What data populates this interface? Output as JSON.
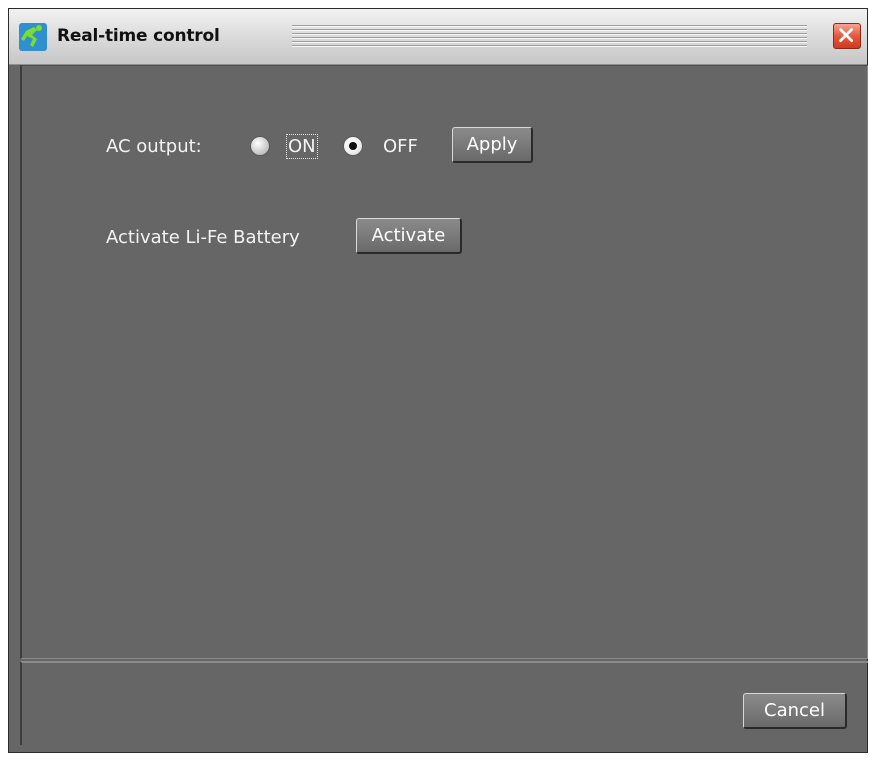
{
  "window": {
    "title": "Real-time control",
    "app_icon": "runner-icon",
    "close_icon": "close-icon"
  },
  "ac_output": {
    "label": "AC output:",
    "options": [
      {
        "label": "ON",
        "selected": false
      },
      {
        "label": "OFF",
        "selected": true
      }
    ],
    "apply_label": "Apply"
  },
  "battery": {
    "label": "Activate Li-Fe Battery",
    "activate_label": "Activate"
  },
  "footer": {
    "cancel_label": "Cancel"
  },
  "colors": {
    "panel": "#666666",
    "text": "#f3f3f3",
    "close": "#e4583c"
  }
}
